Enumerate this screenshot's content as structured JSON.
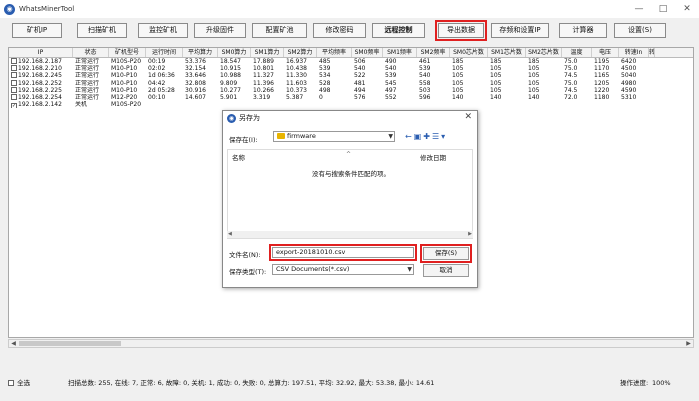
{
  "window": {
    "title": "WhatsMinerTool",
    "minimize": "—",
    "maximize": "□",
    "close": "✕"
  },
  "toolbar": {
    "scan_ip": "矿机IP",
    "scan_miners": "扫描矿机",
    "monitor": "监控矿机",
    "upgrade": "升级固件",
    "config_pools": "配置矿池",
    "change_password": "修改密码",
    "remote_control": "远程控制",
    "export_data": "导出数据",
    "set_ip": "存频和设置IP",
    "calculator": "计算器",
    "settings": "设置(S)"
  },
  "table": {
    "columns": [
      "IP",
      "状态",
      "矿机型号",
      "运行时间",
      "平均算力",
      "SM0算力",
      "SM1算力",
      "SM2算力",
      "平均频率",
      "SM0频率",
      "SM1频率",
      "SM2频率",
      "SM0芯片数",
      "SM1芯片数",
      "SM2芯片数",
      "温度",
      "电压",
      "转速In",
      "转"
    ],
    "rows": [
      {
        "checked": false,
        "cells": [
          "192.168.2.187",
          "正常运行",
          "M10S-P20",
          "00:19",
          "53.376",
          "18.547",
          "17.889",
          "16.937",
          "485",
          "506",
          "490",
          "461",
          "185",
          "185",
          "185",
          "75.0",
          "1195",
          "6420"
        ]
      },
      {
        "checked": false,
        "cells": [
          "192.168.2.210",
          "正常运行",
          "M10-P10",
          "02:02",
          "32.154",
          "10.915",
          "10.801",
          "10.438",
          "539",
          "540",
          "540",
          "539",
          "105",
          "105",
          "105",
          "75.0",
          "1170",
          "4500"
        ]
      },
      {
        "checked": false,
        "cells": [
          "192.168.2.245",
          "正常运行",
          "M10-P10",
          "1d 06:36",
          "33.646",
          "10.988",
          "11.327",
          "11.330",
          "534",
          "522",
          "539",
          "540",
          "105",
          "105",
          "105",
          "74.5",
          "1165",
          "5040"
        ]
      },
      {
        "checked": false,
        "cells": [
          "192.168.2.252",
          "正常运行",
          "M10-P10",
          "04:42",
          "32.808",
          "9.809",
          "11.396",
          "11.603",
          "528",
          "481",
          "545",
          "558",
          "105",
          "105",
          "105",
          "75.0",
          "1205",
          "4980"
        ]
      },
      {
        "checked": false,
        "cells": [
          "192.168.2.225",
          "正常运行",
          "M10-P10",
          "2d 05:28",
          "30.916",
          "10.277",
          "10.266",
          "10.373",
          "498",
          "494",
          "497",
          "503",
          "105",
          "105",
          "105",
          "74.5",
          "1220",
          "4590"
        ]
      },
      {
        "checked": false,
        "cells": [
          "192.168.2.254",
          "正常运行",
          "M12-P20",
          "00:10",
          "14.607",
          "5.901",
          "3.319",
          "5.387",
          "0",
          "576",
          "552",
          "596",
          "140",
          "140",
          "140",
          "72.0",
          "1180",
          "5310"
        ]
      },
      {
        "checked": true,
        "cells": [
          "192.168.2.142",
          "关机",
          "M10S-P20",
          "",
          "",
          "",
          "",
          "",
          "",
          "",
          "",
          "",
          "",
          "",
          "",
          "",
          "",
          ""
        ]
      }
    ]
  },
  "dialog": {
    "title": "另存为",
    "save_in_label": "保存在(I):",
    "save_in_value": "firmware",
    "col_name": "名称",
    "col_modified": "修改日期",
    "empty_message": "没有与搜索条件匹配的项。",
    "filename_label": "文件名(N):",
    "filename_value": "export-20181010.csv",
    "filetype_label": "保存类型(T):",
    "filetype_value": "CSV Documents(*.csv)",
    "save_button": "保存(S)",
    "cancel_button": "取消"
  },
  "status": {
    "select_all": "全选",
    "summary": "扫描总数: 255, 在线: 7, 正常: 6, 故障: 0, 关机: 1, 成功: 0, 失败: 0, 总算力: 197.51, 平均: 32.92, 最大: 53.38, 最小: 14.61",
    "progress_label": "操作进度:",
    "progress_value": "100%"
  }
}
